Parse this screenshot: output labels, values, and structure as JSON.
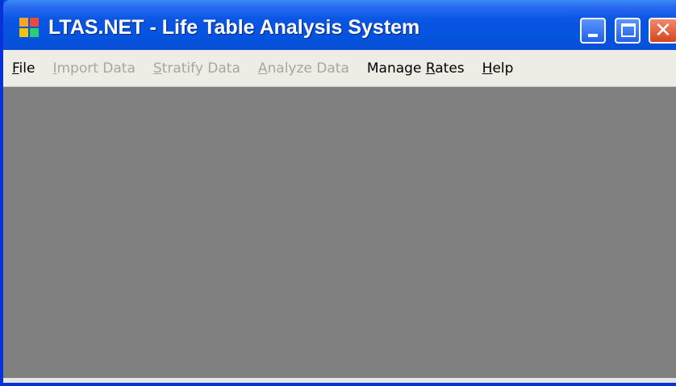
{
  "window": {
    "title": "LTAS.NET - Life Table Analysis System",
    "controls": {
      "minimize": "",
      "maximize": "",
      "close": "✕"
    }
  },
  "menubar": {
    "items": [
      {
        "label": "File",
        "mnemonic": "F",
        "rest": "ile",
        "enabled": true
      },
      {
        "label": "Import Data",
        "mnemonic": "I",
        "rest": "mport Data",
        "enabled": false
      },
      {
        "label": "Stratify Data",
        "mnemonic": "S",
        "rest": "tratify Data",
        "enabled": false
      },
      {
        "label": "Analyze Data",
        "mnemonic": "A",
        "rest": "nalyze Data",
        "enabled": false
      },
      {
        "label": "Manage Rates",
        "mnemonic_prefix": "Manage ",
        "mnemonic": "R",
        "rest": "ates",
        "enabled": true
      },
      {
        "label": "Help",
        "mnemonic": "H",
        "rest": "elp",
        "enabled": true
      }
    ]
  },
  "colors": {
    "titlebar": "#0a55e3",
    "menubar": "#eeede5",
    "client_area": "#808080",
    "disabled_text": "#a7a6a0"
  }
}
